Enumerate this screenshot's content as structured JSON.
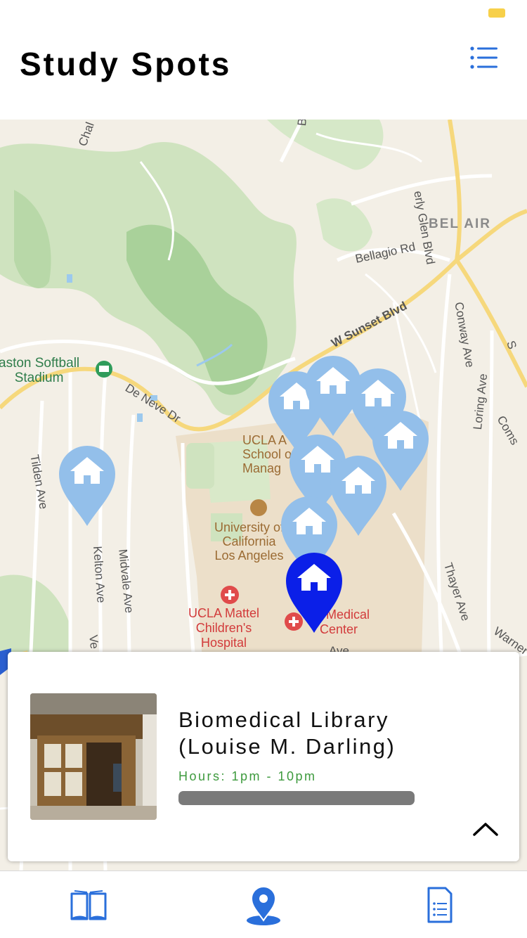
{
  "header": {
    "title": "Study Spots",
    "list_icon": "list-icon"
  },
  "map": {
    "road_labels": {
      "beverly_glen": "erly Glen Blvd",
      "bellagio": "Bellagio Rd",
      "sunset": "W Sunset Blvd",
      "conway": "Conway Ave",
      "de_neve": "De Neve Dr",
      "tilden": "Tilden Ave",
      "kelton": "Kelton Ave",
      "midvale": "Midvale Ave",
      "loring": "Loring Ave",
      "thayer": "Thayer Ave",
      "warner": "Warner",
      "comstock": "Coms",
      "sunset_s": "S",
      "chalon": "Chal",
      "ave": "Ave",
      "ve": "Ve",
      "b": "B"
    },
    "area_label": "BEL AIR",
    "place_labels": {
      "stadium": "aston Softball\nStadium",
      "anderson": "UCLA A     on\nSchool of\nManag     ment",
      "university": "University of\nCalifornia\nLos Angeles",
      "mattel": "UCLA Mattel\nChildren's\nHospital",
      "medical": "LA Medical\nCenter"
    },
    "pin_color": "#93bfea",
    "selected_pin_color": "#0b1fe8",
    "pin_icon": "house-icon"
  },
  "card": {
    "title": "Biomedical Library\n(Louise M. Darling)",
    "hours": "Hours: 1pm - 10pm",
    "hours_color": "#3d9a3d",
    "expand_icon": "chevron-up-icon"
  },
  "tabs": [
    {
      "icon": "book-icon"
    },
    {
      "icon": "map-pin-icon"
    },
    {
      "icon": "document-list-icon"
    }
  ],
  "accent_color": "#2a6fdb"
}
